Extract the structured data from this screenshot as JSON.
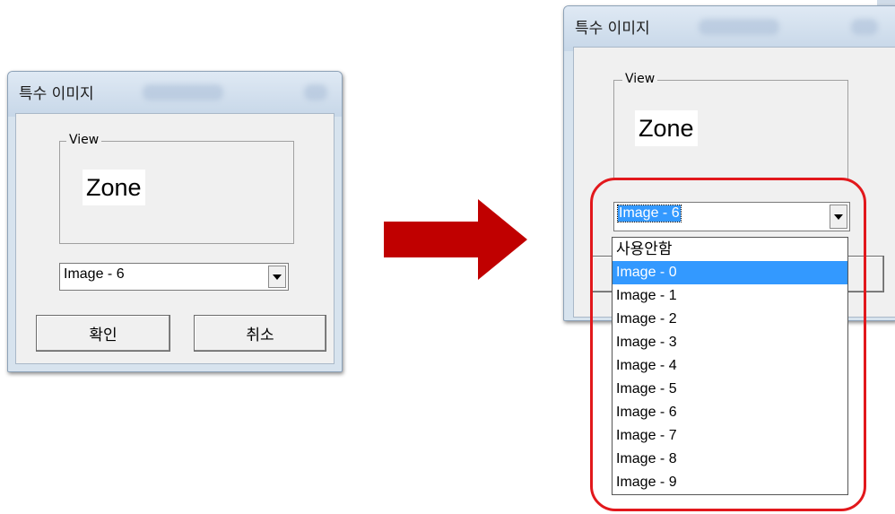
{
  "before_dialog": {
    "title": "특수 이미지",
    "groupbox_label": "View",
    "preview_text": "Zone",
    "combo_value": "Image - 6",
    "ok_label": "확인",
    "cancel_label": "취소"
  },
  "after_dialog": {
    "title": "특수 이미지",
    "groupbox_label": "View",
    "preview_text": "Zone",
    "combo_value": "Image - 6"
  },
  "dropdown": {
    "options": [
      "사용안함",
      "Image - 0",
      "Image - 1",
      "Image - 2",
      "Image - 3",
      "Image - 4",
      "Image - 5",
      "Image - 6",
      "Image - 7",
      "Image - 8",
      "Image - 9"
    ],
    "highlighted_index": 1
  },
  "colors": {
    "arrow": "#c00000",
    "highlight_ring": "#e2181c",
    "selection": "#3399ff"
  }
}
